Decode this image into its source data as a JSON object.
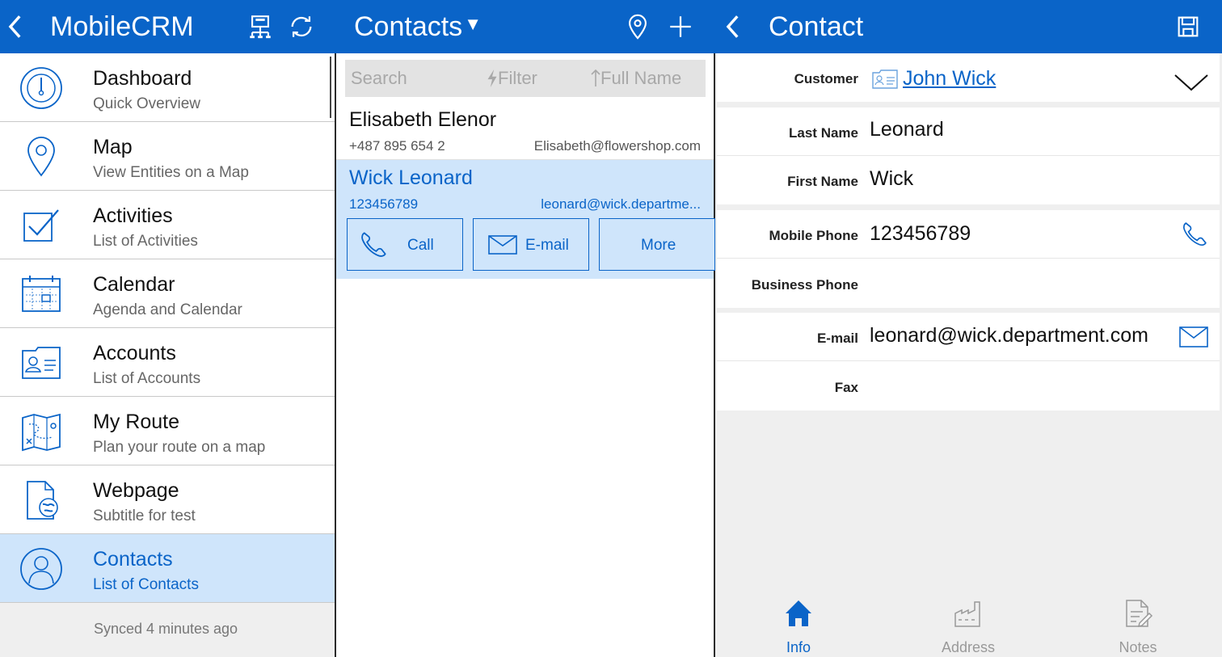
{
  "header": {
    "app_title": "MobileCRM",
    "list_title": "Contacts",
    "list_title_caret": "▼",
    "detail_title": "Contact",
    "accent_color": "#0a64c8"
  },
  "nav": {
    "items": [
      {
        "title": "Dashboard",
        "subtitle": "Quick Overview",
        "icon": "dashboard-gauge-icon"
      },
      {
        "title": "Map",
        "subtitle": "View Entities on a Map",
        "icon": "map-pin-icon"
      },
      {
        "title": "Activities",
        "subtitle": "List of Activities",
        "icon": "checkbox-icon"
      },
      {
        "title": "Calendar",
        "subtitle": "Agenda and Calendar",
        "icon": "calendar-icon"
      },
      {
        "title": "Accounts",
        "subtitle": "List of Accounts",
        "icon": "id-card-icon"
      },
      {
        "title": "My Route",
        "subtitle": "Plan your route on a map",
        "icon": "route-map-icon"
      },
      {
        "title": "Webpage",
        "subtitle": "Subtitle for test",
        "icon": "webpage-globe-icon"
      },
      {
        "title": "Contacts",
        "subtitle": "List of Contacts",
        "icon": "person-icon"
      }
    ],
    "active_index": 7,
    "footer": "Synced 4 minutes ago"
  },
  "list": {
    "search_placeholder": "Search",
    "filter_label": "Filter",
    "sort_label": "Full Name",
    "contacts": [
      {
        "name": "Elisabeth Elenor",
        "phone": "+487 895 654 2",
        "email": "Elisabeth@flowershop.com"
      },
      {
        "name": "Wick Leonard",
        "phone": "123456789",
        "email": "leonard@wick.departme..."
      }
    ],
    "actions": {
      "call": "Call",
      "email": "E-mail",
      "more": "More"
    }
  },
  "detail": {
    "customer_label": "Customer",
    "customer_value": "John Wick",
    "last_name_label": "Last Name",
    "last_name_value": "Leonard",
    "first_name_label": "First Name",
    "first_name_value": "Wick",
    "mobile_phone_label": "Mobile Phone",
    "mobile_phone_value": "123456789",
    "business_phone_label": "Business Phone",
    "business_phone_value": "",
    "email_label": "E-mail",
    "email_value": "leonard@wick.department.com",
    "fax_label": "Fax",
    "fax_value": ""
  },
  "tabs": [
    {
      "label": "Info",
      "icon": "home-icon",
      "active": true
    },
    {
      "label": "Address",
      "icon": "factory-icon",
      "active": false
    },
    {
      "label": "Notes",
      "icon": "notes-icon",
      "active": false
    }
  ]
}
